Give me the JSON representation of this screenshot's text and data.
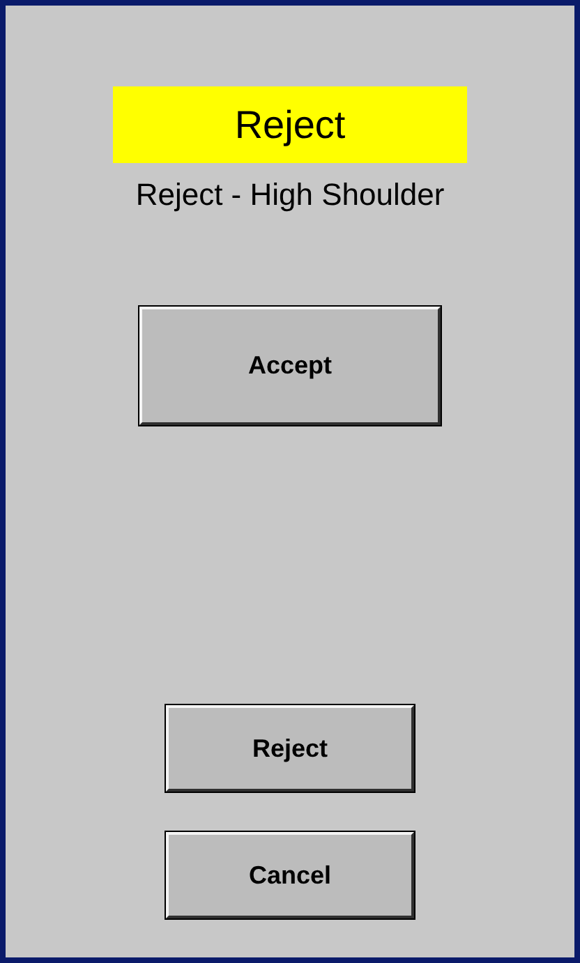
{
  "status_banner": "Reject",
  "message": "Reject - High Shoulder",
  "primary_button": "Accept",
  "buttons": [
    "Reject",
    "Cancel"
  ]
}
